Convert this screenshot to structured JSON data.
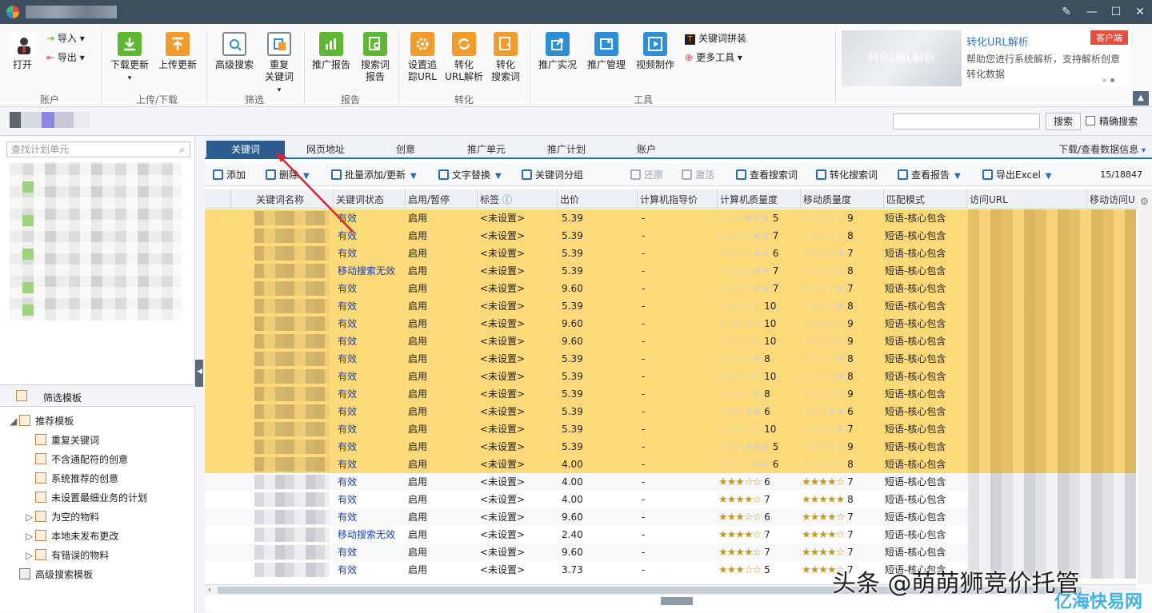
{
  "window": {
    "minimize": "—",
    "maximize": "☐",
    "close": "✕",
    "edit": "✎"
  },
  "ribbon": {
    "account": {
      "open": "打开",
      "import": "导入",
      "export": "导出",
      "group": "账户"
    },
    "sync": {
      "download": "下载更新",
      "upload": "上传更新",
      "group": "上传/下载"
    },
    "filter": {
      "adv_search": "高级搜索",
      "dup_line1": "重复",
      "dup_line2": "关键词",
      "group": "筛选"
    },
    "report": {
      "promo_report": "推广报告",
      "sq_line1": "搜索词",
      "sq_line2": "报告",
      "group": "报告"
    },
    "convert": {
      "track_line1": "设置追",
      "track_line2": "踪URL",
      "url_line1": "转化",
      "url_line2": "URL解析",
      "cs_line1": "转化",
      "cs_line2": "搜索词",
      "group": "转化"
    },
    "tools": {
      "live": "推广实况",
      "manage": "推广管理",
      "video": "视频制作",
      "kw_concat": "关键词拼装",
      "more": "更多工具",
      "group": "工具"
    },
    "ad": {
      "image_text": "转化URL解析",
      "title": "转化URL解析",
      "desc": "帮助您进行系统解析，支持解析创意转化数据",
      "badge": "客户端"
    }
  },
  "search": {
    "button": "搜索",
    "exact": "精确搜索"
  },
  "left": {
    "plan_placeholder": "查找计划单元",
    "tmpl_header": "筛选模板",
    "recommended": "推荐模板",
    "items": [
      "重复关键词",
      "不含通配符的创意",
      "系统推荐的创意",
      "未设置最细业务的计划"
    ],
    "folders": [
      "为空的物料",
      "本地未发布更改",
      "有错误的物料"
    ],
    "advanced": "高级搜索模板"
  },
  "tabs": [
    "关键词",
    "网页地址",
    "创意",
    "推广单元",
    "推广计划",
    "账户"
  ],
  "tab_right": "下载/查看数据信息",
  "toolbar": {
    "add": "添加",
    "delete": "删除",
    "batch": "批量添加/更新",
    "replace": "文字替换",
    "group": "关键词分组",
    "restore": "还原",
    "activate": "激活",
    "view_sq": "查看搜索词",
    "conv_sq": "转化搜索词",
    "view_report": "查看报告",
    "export": "导出Excel",
    "count": "15/18847"
  },
  "columns": [
    "关键词名称",
    "关键词状态",
    "启用/暂停",
    "标签",
    "出价",
    "计算机指导价",
    "计算机质量度",
    "移动质量度",
    "匹配模式",
    "访问URL",
    "移动访问U"
  ],
  "rows": [
    {
      "status": "有效",
      "enabled": "启用",
      "tag": "<未设置>",
      "bid": "5.39",
      "guide": "-",
      "pc": 5,
      "pc_stars": "☆☆☆★★★",
      "mobile": 9,
      "mob_stars": "☆☆☆☆☆",
      "match": "短语-核心包含",
      "hl": true
    },
    {
      "status": "有效",
      "enabled": "启用",
      "tag": "<未设置>",
      "bid": "5.39",
      "guide": "-",
      "pc": 7,
      "pc_stars": "☆☆☆☆★★",
      "mobile": 8,
      "mob_stars": "☆☆☆☆☆",
      "match": "短语-核心包含",
      "hl": true
    },
    {
      "status": "有效",
      "enabled": "启用",
      "tag": "<未设置>",
      "bid": "5.39",
      "guide": "-",
      "pc": 6,
      "pc_stars": "☆☆☆☆★★",
      "mobile": 7,
      "mob_stars": "☆☆☆☆★",
      "match": "短语-核心包含",
      "hl": true
    },
    {
      "status": "移动搜索无效",
      "enabled": "启用",
      "tag": "<未设置>",
      "bid": "5.39",
      "guide": "-",
      "pc": 7,
      "pc_stars": "☆☆☆☆★★",
      "mobile": 8,
      "mob_stars": "☆☆☆☆☆",
      "match": "短语-核心包含",
      "hl": true
    },
    {
      "status": "有效",
      "enabled": "启用",
      "tag": "<未设置>",
      "bid": "9.60",
      "guide": "-",
      "pc": 7,
      "pc_stars": "☆☆☆☆★★",
      "mobile": 7,
      "mob_stars": "☆☆☆☆★",
      "match": "短语-核心包含",
      "hl": true
    },
    {
      "status": "有效",
      "enabled": "启用",
      "tag": "<未设置>",
      "bid": "5.39",
      "guide": "-",
      "pc": 10,
      "pc_stars": "☆☆☆☆☆",
      "mobile": 8,
      "mob_stars": "☆☆☆☆★",
      "match": "短语-核心包含",
      "hl": true
    },
    {
      "status": "有效",
      "enabled": "启用",
      "tag": "<未设置>",
      "bid": "9.60",
      "guide": "-",
      "pc": 10,
      "pc_stars": "☆☆☆☆☆",
      "mobile": 9,
      "mob_stars": "☆☆☆☆☆",
      "match": "短语-核心包含",
      "hl": true
    },
    {
      "status": "有效",
      "enabled": "启用",
      "tag": "<未设置>",
      "bid": "9.60",
      "guide": "-",
      "pc": 10,
      "pc_stars": "☆☆☆☆☆",
      "mobile": 9,
      "mob_stars": "☆☆☆☆☆",
      "match": "短语-核心包含",
      "hl": true
    },
    {
      "status": "有效",
      "enabled": "启用",
      "tag": "<未设置>",
      "bid": "5.39",
      "guide": "-",
      "pc": 8,
      "pc_stars": "☆☆☆☆★",
      "mobile": 8,
      "mob_stars": "☆☆☆☆★",
      "match": "短语-核心包含",
      "hl": true
    },
    {
      "status": "有效",
      "enabled": "启用",
      "tag": "<未设置>",
      "bid": "5.39",
      "guide": "-",
      "pc": 10,
      "pc_stars": "☆☆☆☆☆",
      "mobile": 8,
      "mob_stars": "☆☆☆☆★",
      "match": "短语-核心包含",
      "hl": true
    },
    {
      "status": "有效",
      "enabled": "启用",
      "tag": "<未设置>",
      "bid": "5.39",
      "guide": "-",
      "pc": 8,
      "pc_stars": "☆☆☆☆★",
      "mobile": 9,
      "mob_stars": "☆☆☆☆☆",
      "match": "短语-核心包含",
      "hl": true
    },
    {
      "status": "有效",
      "enabled": "启用",
      "tag": "<未设置>",
      "bid": "5.39",
      "guide": "-",
      "pc": 6,
      "pc_stars": "☆☆☆★★",
      "mobile": 6,
      "mob_stars": "☆☆☆★★",
      "match": "短语-核心包含",
      "hl": true
    },
    {
      "status": "有效",
      "enabled": "启用",
      "tag": "<未设置>",
      "bid": "5.39",
      "guide": "-",
      "pc": 10,
      "pc_stars": "☆☆☆☆☆",
      "mobile": 7,
      "mob_stars": "☆☆☆☆★",
      "match": "短语-核心包含",
      "hl": true
    },
    {
      "status": "有效",
      "enabled": "启用",
      "tag": "<未设置>",
      "bid": "5.39",
      "guide": "-",
      "pc": 5,
      "pc_stars": "☆☆☆★★★",
      "mobile": 9,
      "mob_stars": "☆☆☆☆☆",
      "match": "短语-核心包含",
      "hl": true
    },
    {
      "status": "有效",
      "enabled": "启用",
      "tag": "<未设置>",
      "bid": "4.00",
      "guide": "-",
      "pc": 6,
      "pc_stars": "☆☆☆☆★★",
      "mobile": 8,
      "mob_stars": "☆☆☆☆☆",
      "match": "短语-核心包含",
      "hl": true
    },
    {
      "status": "有效",
      "enabled": "启用",
      "tag": "<未设置>",
      "bid": "4.00",
      "guide": "-",
      "pc": 6,
      "pc_stars": "★★★☆☆",
      "mobile": 7,
      "mob_stars": "★★★★☆",
      "match": "短语-核心包含",
      "hl": false
    },
    {
      "status": "有效",
      "enabled": "启用",
      "tag": "<未设置>",
      "bid": "4.00",
      "guide": "-",
      "pc": 7,
      "pc_stars": "★★★★☆",
      "mobile": 8,
      "mob_stars": "★★★★★",
      "match": "短语-核心包含",
      "hl": false
    },
    {
      "status": "有效",
      "enabled": "启用",
      "tag": "<未设置>",
      "bid": "9.60",
      "guide": "-",
      "pc": 6,
      "pc_stars": "★★★☆☆",
      "mobile": 7,
      "mob_stars": "★★★★☆",
      "match": "短语-核心包含",
      "hl": false
    },
    {
      "status": "移动搜索无效",
      "enabled": "启用",
      "tag": "<未设置>",
      "bid": "2.40",
      "guide": "-",
      "pc": 7,
      "pc_stars": "★★★★☆",
      "mobile": 7,
      "mob_stars": "★★★★☆",
      "match": "短语-核心包含",
      "hl": false
    },
    {
      "status": "有效",
      "enabled": "启用",
      "tag": "<未设置>",
      "bid": "9.60",
      "guide": "-",
      "pc": 7,
      "pc_stars": "★★★★☆",
      "mobile": 7,
      "mob_stars": "★★★★☆",
      "match": "短语-核心包含",
      "hl": false
    },
    {
      "status": "有效",
      "enabled": "启用",
      "tag": "<未设置>",
      "bid": "3.73",
      "guide": "-",
      "pc": 5,
      "pc_stars": "★★★☆☆",
      "mobile": 7,
      "mob_stars": "★★★★☆",
      "match": "短语-核心包含",
      "hl": false
    }
  ],
  "watermark": "头条 @萌萌狮竞价托管",
  "watermark2": "亿海快易网",
  "colors": {
    "highlight": "#fcd979",
    "tab_active": "#2c5c8f",
    "accent": "#2a6cb7",
    "titlebar": "#3f4e5f"
  }
}
